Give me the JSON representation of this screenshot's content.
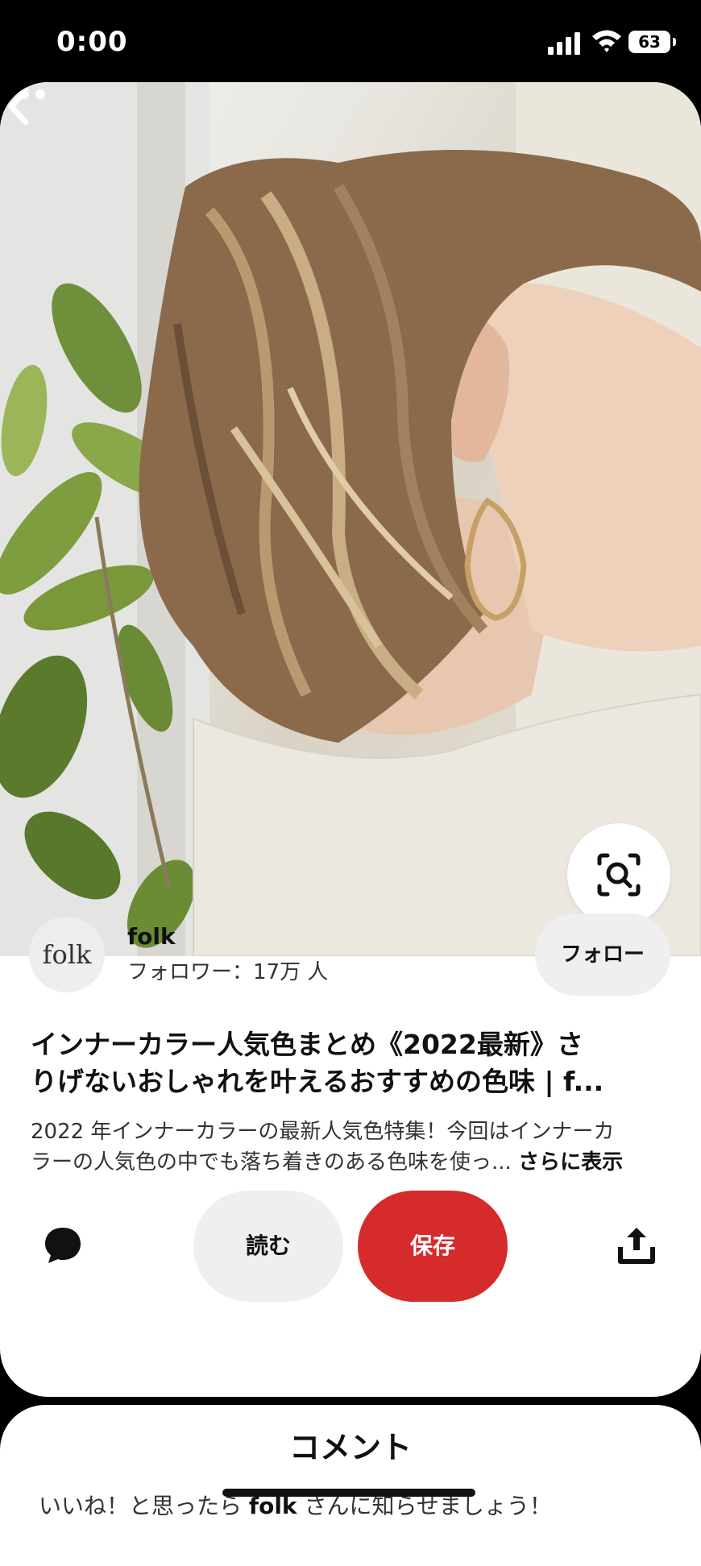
{
  "status_bar": {
    "time": "0:00",
    "battery": "63",
    "icons": [
      "signal-icon",
      "wifi-icon",
      "battery-icon"
    ]
  },
  "pin": {
    "image_alt": "",
    "top_controls": {
      "back_icon": "chevron-left-icon",
      "more_icon": "ellipsis-icon",
      "visual_search_icon": "lens-search-icon"
    },
    "creator": {
      "avatar_text": "folk",
      "name": "folk",
      "followers": "フォロワー：17万 人",
      "follow_label": "フォロー"
    },
    "title": [
      "インナーカラー人気色まとめ《2022最新》さ",
      "りげないおしゃれを叶えるおすすめの色味 | f..."
    ],
    "description": [
      "2022 年インナーカラーの最新人気色特集！今回はインナーカ",
      "ラーの人気色の中でも落ち着きのある色味を使っ... "
    ],
    "show_more": "さらに表示",
    "actions": {
      "comment_icon": "comment-icon",
      "read_label": "読む",
      "save_label": "保存",
      "share_icon": "share-icon"
    }
  },
  "comments": {
    "title": "コメント",
    "hint_prefix": "いいね！と思ったら ",
    "hint_creator": "folk",
    "hint_suffix": " さんに知らせましょう！"
  },
  "colors": {
    "save_red": "#d62b2b",
    "button_gray": "#efefef"
  }
}
